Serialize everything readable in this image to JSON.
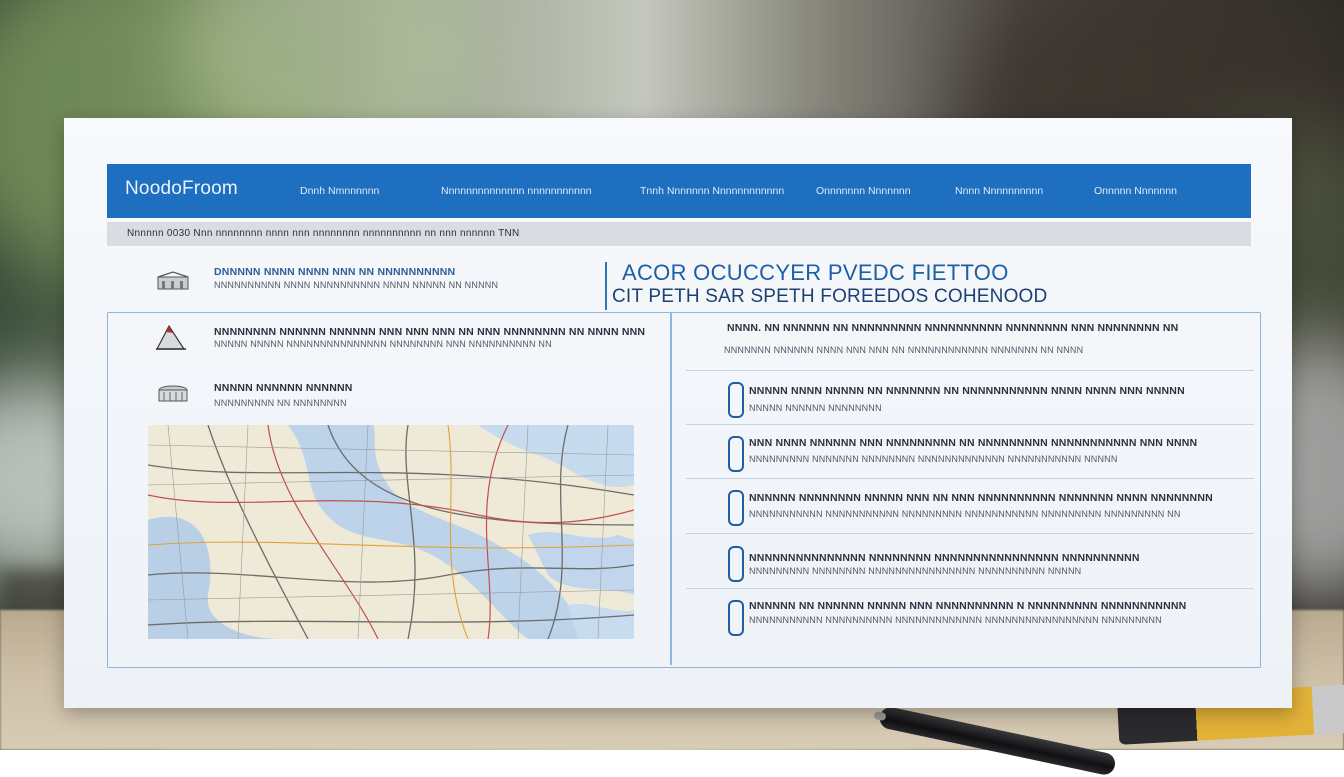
{
  "navbar": {
    "logo": "NoodoFroom",
    "items": [
      "Dnnh Nmnnnnnn",
      "Nnnnnnnnnnnnnn nnnnnnnnnnn",
      "Tnnh Nnnnnnn Nnnnnnnnnnnn",
      "Onnnnnnn Nnnnnnn",
      "Nnnn Nnnnnnnnnn",
      "Onnnnn Nnnnnnn"
    ]
  },
  "infobar": {
    "text": "Nnnnnn 0030 Nnn nnnnnnnn nnnn nnn nnnnnnnn nnnnnnnnnn nn nnn nnnnnn TNN"
  },
  "left_rows": [
    {
      "title": "DNNNNN NNNN   NNNN NNN NN  NNNNNNNNNN",
      "sub": "NNNNNNNNNN NNNN NNNNNNNNNN NNNN NNNNN NN NNNNN"
    },
    {
      "title": "NNNNNNNN NNNNNN NNNNNN NNN NNN NNN NN NNN NNNNNNNN NN NNNN NNN",
      "sub": "NNNNN NNNNN NNNNNNNNNNNNNNN NNNNNNNN NNN NNNNNNNNNN   NN"
    },
    {
      "title": "NNNNN NNNNNN  NNNNNN",
      "sub": "NNNNNNNNN NN NNNNNNNN"
    }
  ],
  "headline": "ACOR OCUCCYER PVEDC FIETTOO",
  "subhead": "CIT PETH SAR SPETH FOREEDOS COHENOOD",
  "right_top": {
    "title": "NNNN.  NN NNNNNN NN NNNNNNNNN NNNNNNNNNN NNNNNNNN NNN NNNNNNNN NN",
    "sub": "NNNNNNN NNNNNN NNNN NNN  NNN  NN  NNNNNNNNNNNN NNNNNNN NN NNNN"
  },
  "right_items": [
    {
      "title": "NNNNN NNNN NNNNN NN NNNNNNN NN NNNNNNNNNNN NNNN NNNN NNN NNNNN",
      "sub": "NNNNN NNNNNN NNNNNNNN"
    },
    {
      "title": "NNN NNNN NNNNNN NNN NNNNNNNNN  NN  NNNNNNNNN NNNNNNNNNNN NNN NNNN",
      "sub": "NNNNNNNNN NNNNNNN NNNNNNNN NNNNNNNNNNNNN NNNNNNNNNNN NNNNN"
    },
    {
      "title": "NNNNNN NNNNNNNN NNNNN NNN NN NNN NNNNNNNNNN NNNNNNN NNNN NNNNNNNN",
      "sub": "NNNNNNNNNNN NNNNNNNNNNN NNNNNNNNN NNNNNNNNNNN NNNNNNNNN NNNNNNNNN NN"
    },
    {
      "title": "NNNNNNNNNNNNNNN NNNNNNNN NNNNNNNNNNNNNNNN NNNNNNNNNN",
      "sub": "NNNNNNNNN NNNNNNNN NNNNNNNNNNNNNNNN NNNNNNNNNN NNNNN"
    },
    {
      "title": "NNNNNN NN NNNNNN NNNNN NNN NNNNNNNNNN N  NNNNNNNNN NNNNNNNNNNN",
      "sub": "NNNNNNNNNNN NNNNNNNNNN NNNNNNNNNNNNN NNNNNNNNNNNNNNNNN NNNNNNNNN"
    }
  ],
  "colors": {
    "nav": "#1e6fbf",
    "accent": "#1f5fa8",
    "panel_border": "#8fb7de"
  },
  "icons": {
    "row1": "building-icon",
    "row2": "mountain-icon",
    "row3": "stadium-icon",
    "list": "bracket-icon"
  }
}
